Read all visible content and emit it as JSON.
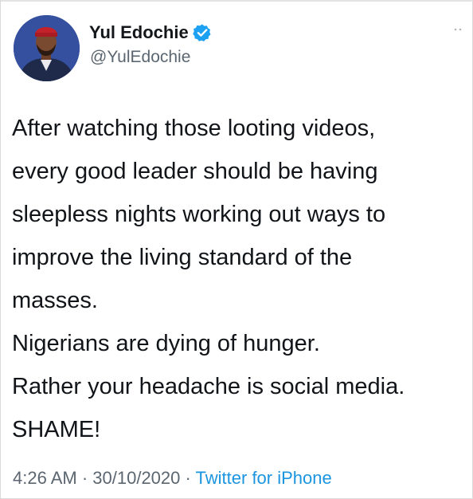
{
  "author": {
    "display_name": "Yul Edochie",
    "handle": "@YulEdochie",
    "verified": true
  },
  "tweet": {
    "lines": [
      "After watching those looting videos,",
      "every good leader should be having",
      "sleepless nights working out ways to",
      "improve the living standard of the",
      "masses.",
      "Nigerians are dying of hunger.",
      "Rather your headache is social media.",
      "SHAME!"
    ]
  },
  "meta": {
    "time": "4:26 AM",
    "separator": " · ",
    "date": "30/10/2020",
    "source": "Twitter for iPhone"
  },
  "colors": {
    "verified_badge": "#1da1f2",
    "source_link": "#1b95e0",
    "secondary_text": "#5b6670"
  },
  "icons": {
    "verified": "verified-badge-icon",
    "more": "more-dots-icon"
  }
}
